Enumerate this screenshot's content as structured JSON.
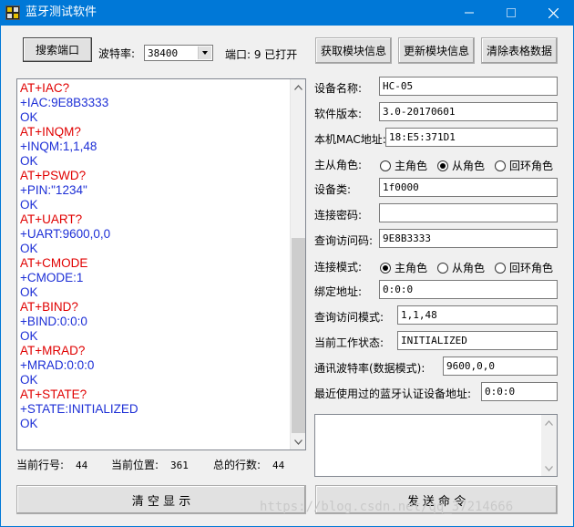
{
  "window": {
    "title": "蓝牙测试软件",
    "minimize_glyph": "—",
    "maximize_glyph": "☐",
    "close_glyph": "✕",
    "title_color": "#0078d7"
  },
  "toolbar": {
    "search_port_label": "搜索端口",
    "baud_label": "波特率:",
    "baud_value": "38400",
    "port_status": "端口: 9 已打开",
    "get_info_label": "获取模块信息",
    "update_info_label": "更新模块信息",
    "clear_table_label": "清除表格数据"
  },
  "log": {
    "colors": {
      "cmd": "#e00000",
      "resp": "#1d2fd6"
    },
    "lines": [
      {
        "text": "AT+IAC?",
        "kind": "cmd"
      },
      {
        "text": "+IAC:9E8B3333",
        "kind": "resp"
      },
      {
        "text": "OK",
        "kind": "resp"
      },
      {
        "text": "AT+INQM?",
        "kind": "cmd"
      },
      {
        "text": "+INQM:1,1,48",
        "kind": "resp"
      },
      {
        "text": "OK",
        "kind": "resp"
      },
      {
        "text": "AT+PSWD?",
        "kind": "cmd"
      },
      {
        "text": "+PIN:\"1234\"",
        "kind": "resp"
      },
      {
        "text": "OK",
        "kind": "resp"
      },
      {
        "text": "AT+UART?",
        "kind": "cmd"
      },
      {
        "text": "+UART:9600,0,0",
        "kind": "resp"
      },
      {
        "text": "OK",
        "kind": "resp"
      },
      {
        "text": "AT+CMODE",
        "kind": "cmd"
      },
      {
        "text": "+CMODE:1",
        "kind": "resp"
      },
      {
        "text": "OK",
        "kind": "resp"
      },
      {
        "text": "AT+BIND?",
        "kind": "cmd"
      },
      {
        "text": "+BIND:0:0:0",
        "kind": "resp"
      },
      {
        "text": "OK",
        "kind": "resp"
      },
      {
        "text": "AT+MRAD?",
        "kind": "cmd"
      },
      {
        "text": "+MRAD:0:0:0",
        "kind": "resp"
      },
      {
        "text": "OK",
        "kind": "resp"
      },
      {
        "text": "AT+STATE?",
        "kind": "cmd"
      },
      {
        "text": "+STATE:INITIALIZED",
        "kind": "resp"
      },
      {
        "text": "OK",
        "kind": "resp"
      }
    ]
  },
  "status": {
    "line_label": "当前行号:",
    "line_value": "44",
    "pos_label": "当前位置:",
    "pos_value": "361",
    "total_label": "总的行数:",
    "total_value": "44"
  },
  "form": {
    "device_name_label": "设备名称:",
    "device_name": "HC-05",
    "version_label": "软件版本:",
    "version": "3.0-20170601",
    "mac_label": "本机MAC地址:",
    "mac": "18:E5:371D1",
    "role_label": "主从角色:",
    "role_options": [
      "主角色",
      "从角色",
      "回环角色"
    ],
    "role_selected": "从角色",
    "device_class_label": "设备类:",
    "device_class": "1f0000",
    "password_label": "连接密码:",
    "password": "",
    "iac_label": "查询访问码:",
    "iac": "9E8B3333",
    "conn_mode_label": "连接模式:",
    "conn_mode_options": [
      "主角色",
      "从角色",
      "回环角色"
    ],
    "conn_mode_selected": "主角色",
    "bind_label": "绑定地址:",
    "bind": "0:0:0",
    "inqm_label": "查询访问模式:",
    "inqm": "1,1,48",
    "state_label": "当前工作状态:",
    "state": "INITIALIZED",
    "uart_label": "通讯波特率(数据模式):",
    "uart": "9600,0,0",
    "mrad_label": "最近使用过的蓝牙认证设备地址:",
    "mrad": "0:0:0"
  },
  "bottom": {
    "clear_display_label": "清 空 显 示",
    "send_command_label": "发 送 命 令"
  },
  "watermark": "https://blog.csdn.net/qq_37214666"
}
